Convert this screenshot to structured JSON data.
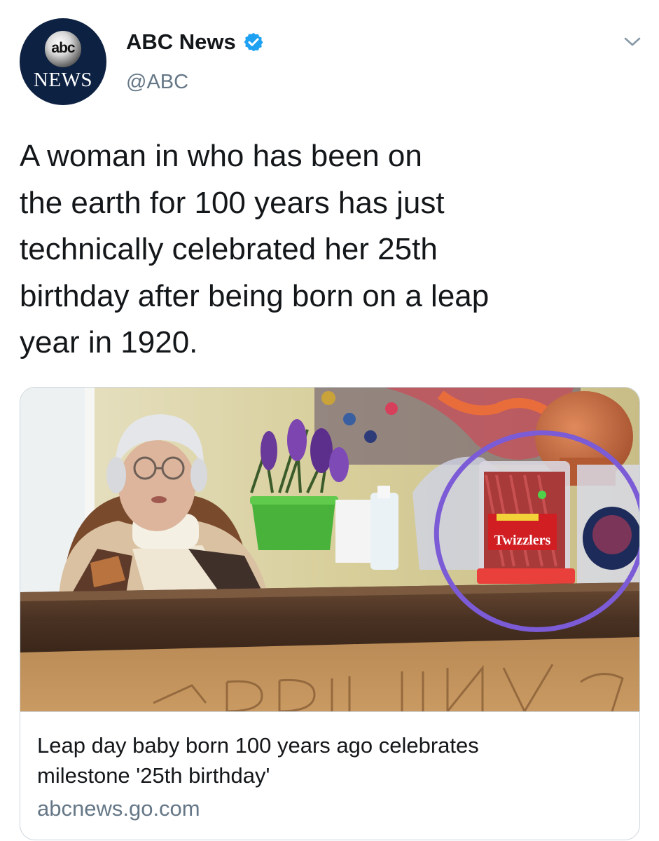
{
  "account": {
    "display_name": "ABC News",
    "handle": "@ABC",
    "verified": true,
    "avatar": {
      "top_text": "abc",
      "bottom_text": "NEWS"
    }
  },
  "tweet": {
    "text_lines": [
      "A woman in who has been on",
      "the earth for 100 years has just",
      "technically celebrated her 25th",
      "birthday after being born on a leap",
      "year in 1920."
    ]
  },
  "link_card": {
    "image": {
      "description_icon": "photo",
      "candy_label": "Twizzlers",
      "highlight_color": "#7b5bd6"
    },
    "title_lines": [
      "Leap day baby born 100 years ago celebrates",
      "milestone '25th birthday'"
    ],
    "domain": "abcnews.go.com"
  },
  "colors": {
    "verified_blue": "#1da1f2",
    "secondary_text": "#657786",
    "border": "#ccd6dd"
  },
  "icons": {
    "more": "chevron-down-icon",
    "verified": "verified-badge-icon"
  }
}
